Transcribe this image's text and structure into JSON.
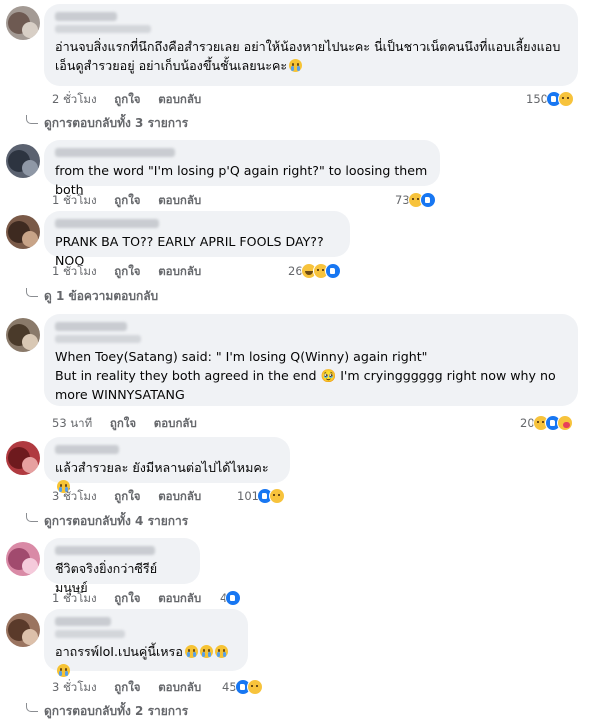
{
  "labels": {
    "like": "ถูกใจ",
    "reply": "ตอบกลับ"
  },
  "comments": [
    {
      "text": "อ่านจบสิ่งแรกที่นึกถึงคือสำรวยเลย อย่าให้น้องหายไปนะคะ นี่เป็นชาวเน็ตคนนึงที่แอบเลี้ยงแอบเอ็นดูสำรวยอยู่ อย่าเก็บน้องขึ้นชั้นเลยนะคะ",
      "time": "2 ชั่วโมง",
      "reaction_count": "150",
      "reactions": [
        "like",
        "sad"
      ],
      "view_replies": "ดูการตอบกลับทั้ง 3 รายการ"
    },
    {
      "text": "from the word \"I'm losing p'Q again right?\" to loosing them both",
      "time": "1 ชั่วโมง",
      "reaction_count": "73",
      "reactions": [
        "sad",
        "like"
      ],
      "view_replies": ""
    },
    {
      "text": "PRANK BA TO?? EARLY APRIL FOOLS DAY?? NOO",
      "time": "1 ชั่วโมง",
      "reaction_count": "26",
      "reactions": [
        "haha",
        "sad",
        "like"
      ],
      "view_replies": "ดู 1 ข้อความตอบกลับ"
    },
    {
      "text": "When Toey(Satang) said: \" I'm losing Q(Winny) again right\"\nBut in reality they both agreed in the end 🥹 I'm cryingggggg right now why no more WINNYSATANG",
      "time": "53 นาที",
      "reaction_count": "20",
      "reactions": [
        "sad",
        "like",
        "care"
      ],
      "view_replies": ""
    },
    {
      "text": "แล้วสำรวยละ ยังมีหลานต่อไปได้ไหมคะ",
      "time": "3 ชั่วโมง",
      "reaction_count": "101",
      "reactions": [
        "like",
        "sad"
      ],
      "view_replies": "ดูการตอบกลับทั้ง 4 รายการ"
    },
    {
      "text": "ชีวิตจริงยิ่งกว่าซีรีย์ มนุษย์",
      "time": "1 ชั่วโมง",
      "reaction_count": "4",
      "reactions": [
        "like"
      ],
      "view_replies": ""
    },
    {
      "text": "อาถรรพ์loI.เปนคู่นี้เหรอ",
      "time": "3 ชั่วโมง",
      "reaction_count": "45",
      "reactions": [
        "like",
        "sad"
      ],
      "view_replies": "ดูการตอบกลับทั้ง 2 รายการ"
    }
  ]
}
